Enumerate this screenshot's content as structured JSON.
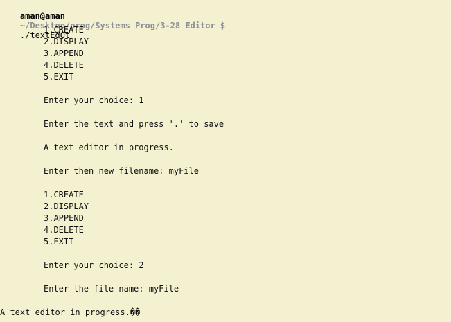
{
  "prompt": {
    "user_host": "aman@aman",
    "path": "~/Desktop/prog/Systems Prog/3-28 Editor $",
    "command": "./textEdOt"
  },
  "menu1": [
    "1.CREATE",
    "2.DISPLAY",
    "3.APPEND",
    "4.DELETE",
    "5.EXIT"
  ],
  "choice1": "Enter your choice: 1",
  "text_prompt": "Enter the text and press '.' to save",
  "typed_text": "A text editor in progress.",
  "filename_prompt": "Enter then new filename: myFile",
  "menu2": [
    "1.CREATE",
    "2.DISPLAY",
    "3.APPEND",
    "4.DELETE",
    "5.EXIT"
  ],
  "choice2": "Enter your choice: 2",
  "file_name_prompt": "Enter the file name: myFile",
  "output": "A text editor in progress.��",
  "colors": {
    "background": "#f4f1d0",
    "text": "#111111",
    "path": "#8a8f98"
  }
}
